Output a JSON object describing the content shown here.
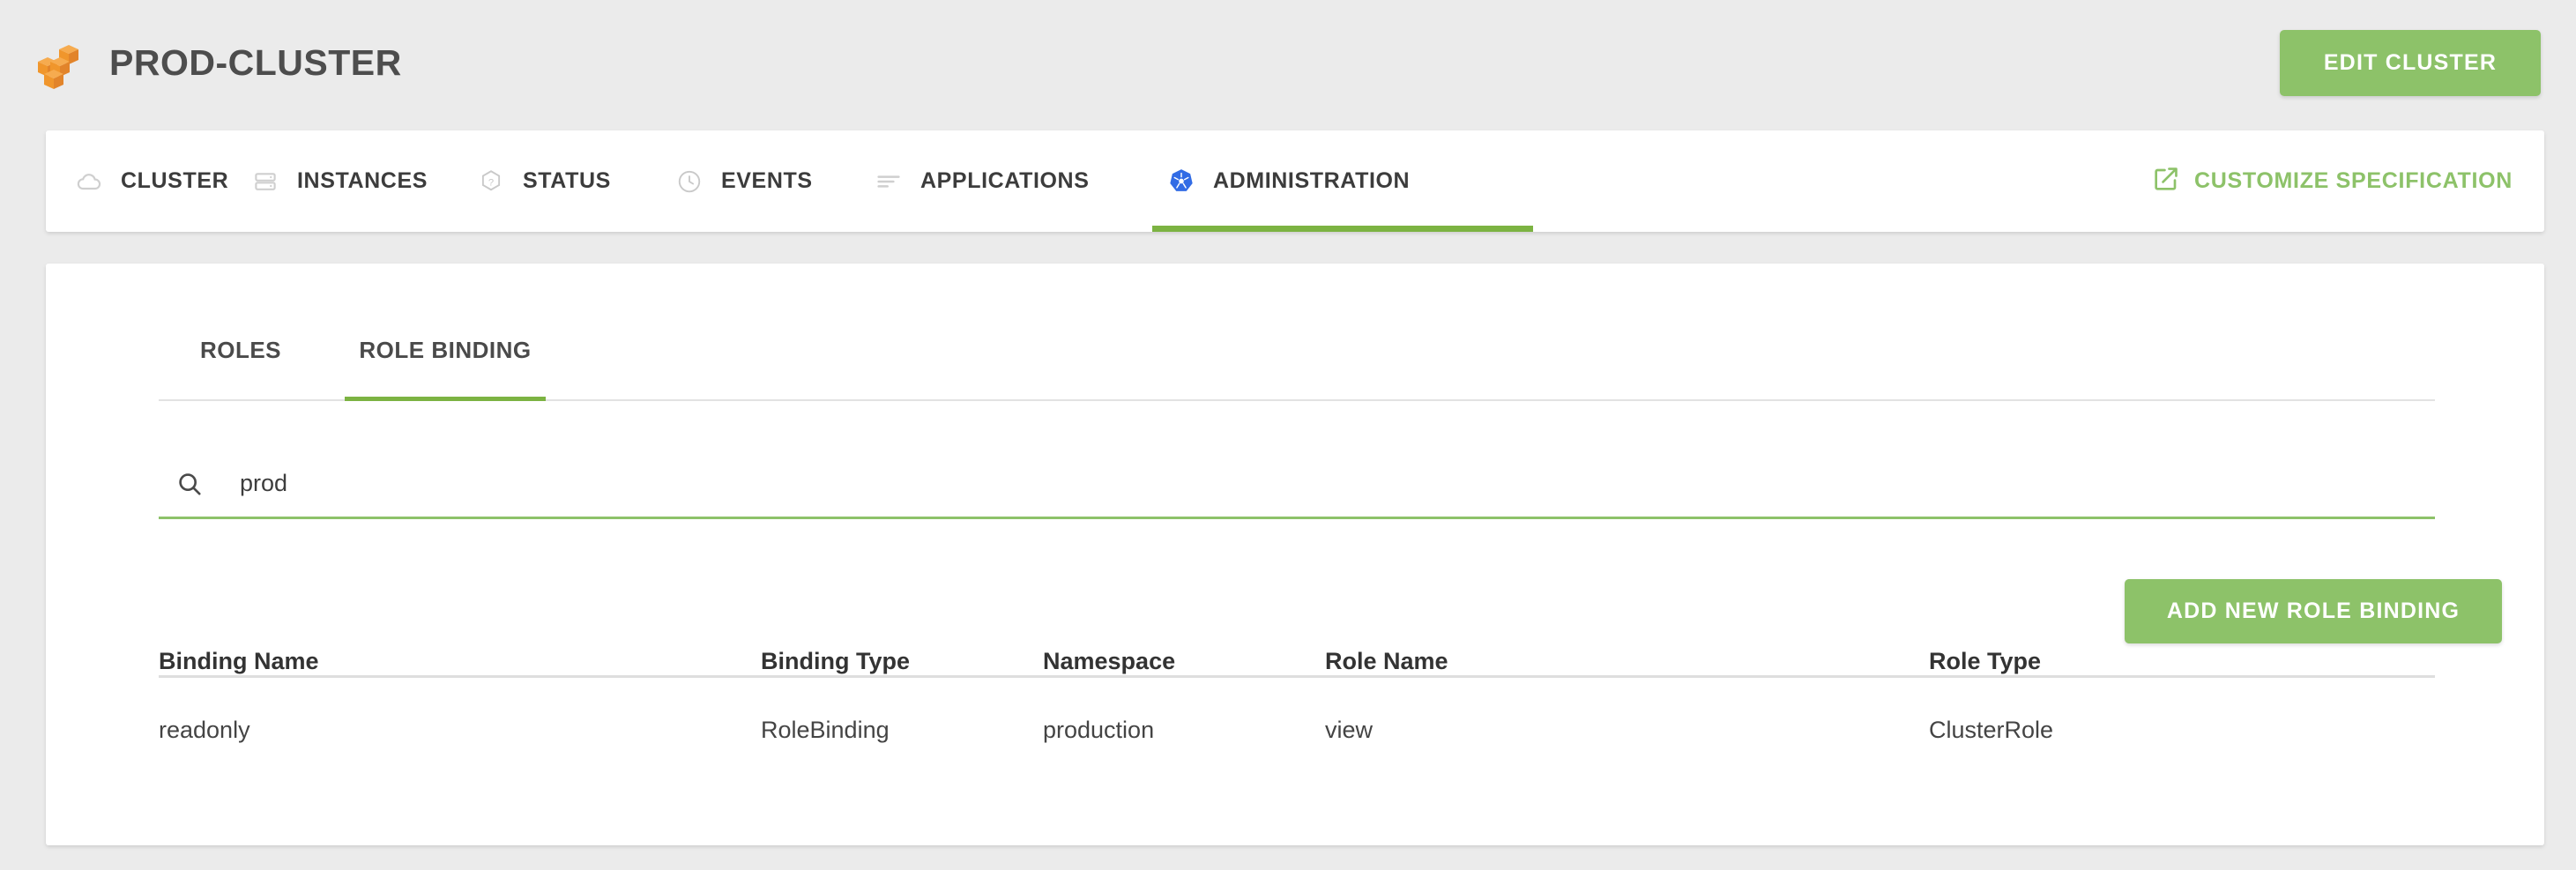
{
  "header": {
    "logo_icon": "aws-cubes-logo-icon",
    "title": "PROD-CLUSTER",
    "edit_button_label": "EDIT CLUSTER"
  },
  "nav": {
    "tabs": [
      {
        "label": "CLUSTER",
        "icon": "cloud-icon",
        "active": false
      },
      {
        "label": "INSTANCES",
        "icon": "server-icon",
        "active": false
      },
      {
        "label": "STATUS",
        "icon": "hexagon-question-icon",
        "active": false
      },
      {
        "label": "EVENTS",
        "icon": "clock-icon",
        "active": false
      },
      {
        "label": "APPLICATIONS",
        "icon": "list-lines-icon",
        "active": false
      },
      {
        "label": "ADMINISTRATION",
        "icon": "kubernetes-icon",
        "active": true
      }
    ],
    "customize_label": "CUSTOMIZE SPECIFICATION",
    "customize_icon": "external-link-icon"
  },
  "main": {
    "subtabs": [
      {
        "label": "ROLES",
        "active": false
      },
      {
        "label": "ROLE BINDING",
        "active": true
      }
    ],
    "search": {
      "icon": "search-icon",
      "value": "prod",
      "placeholder": "Search"
    },
    "add_button_label": "ADD NEW ROLE BINDING",
    "table": {
      "columns": [
        "Binding Name",
        "Binding Type",
        "Namespace",
        "Role Name",
        "Role Type"
      ],
      "rows": [
        {
          "binding_name": "readonly",
          "binding_type": "RoleBinding",
          "namespace": "production",
          "role_name": "view",
          "role_type": "ClusterRole"
        }
      ]
    }
  },
  "colors": {
    "accent_green": "#8dc269",
    "underline_green": "#7cb342",
    "page_background": "#ebebeb",
    "card_background": "#ffffff",
    "logo_orange": "#f0962c",
    "kubernetes_blue": "#326ce5",
    "text_dark": "#3c3c3c"
  }
}
